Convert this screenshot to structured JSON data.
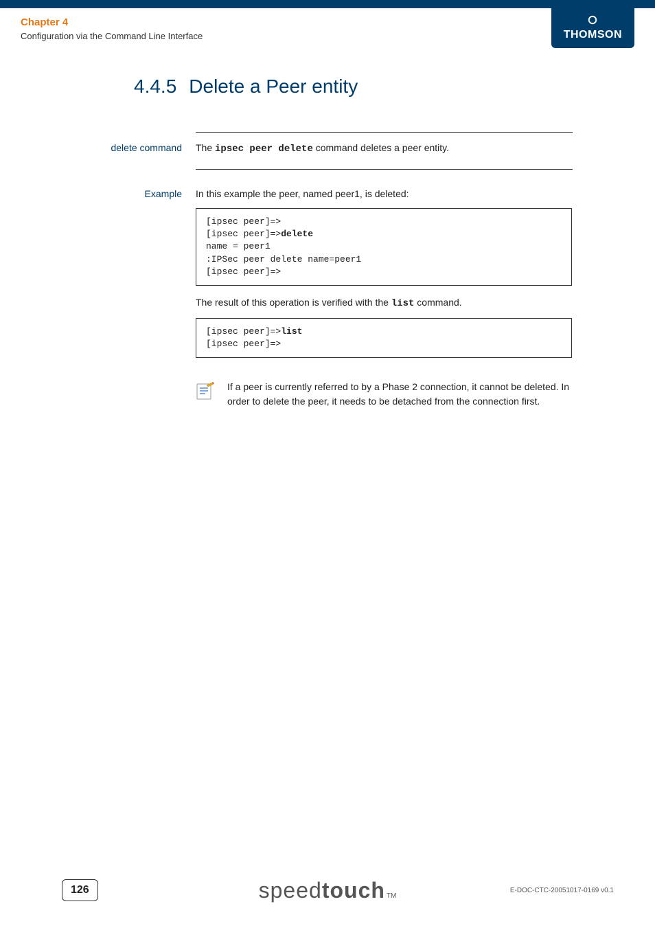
{
  "header": {
    "chapter_label": "Chapter 4",
    "chapter_subtitle": "Configuration via the Command Line Interface",
    "brand": "THOMSON"
  },
  "section": {
    "number": "4.4.5",
    "title": "Delete a Peer entity"
  },
  "delete_command": {
    "label": "delete command",
    "text_prefix": "The ",
    "command": "ipsec peer delete",
    "text_suffix": " command deletes a peer entity."
  },
  "example": {
    "label": "Example",
    "intro": "In this example the peer, named peer1, is deleted:",
    "code1": {
      "line1": "[ipsec peer]=>",
      "line2_prefix": "[ipsec peer]=>",
      "line2_bold": "delete",
      "line3": "name = peer1",
      "line4": ":IPSec peer delete name=peer1",
      "line5": "[ipsec peer]=>"
    },
    "verify_prefix": "The result of this operation is verified with the ",
    "verify_cmd": "list",
    "verify_suffix": " command.",
    "code2": {
      "line1_prefix": "[ipsec peer]=>",
      "line1_bold": "list",
      "line2": "[ipsec peer]=>"
    },
    "note": "If a peer is currently referred to by a Phase 2 connection, it cannot be deleted. In order to delete the peer, it needs to be detached from the connection first."
  },
  "footer": {
    "page_number": "126",
    "logo_speed": "speed",
    "logo_touch": "touch",
    "logo_tm": "TM",
    "doc_ref": "E-DOC-CTC-20051017-0169 v0.1"
  }
}
